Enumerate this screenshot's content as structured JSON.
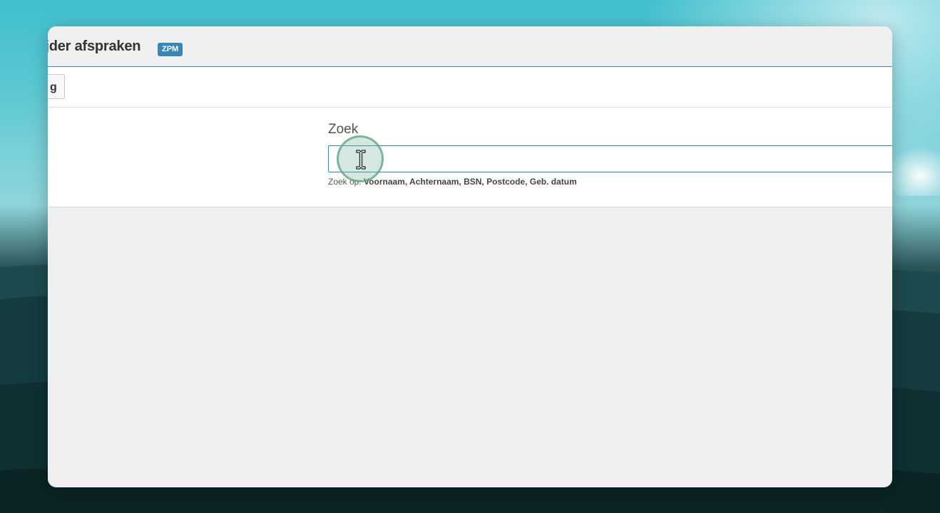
{
  "window": {
    "title": "ijder afspraken",
    "badge": "ZPM"
  },
  "toolbar": {
    "button_label": "g"
  },
  "search": {
    "label": "Zoek",
    "value": "",
    "hint_prefix": "Zoek op:",
    "hint_fields": "Voornaam, Achternaam, BSN, Postcode, Geb. datum"
  },
  "colors": {
    "accent": "#3a86b5",
    "input_border": "#2d8c9a",
    "window_bg": "#efefef"
  }
}
